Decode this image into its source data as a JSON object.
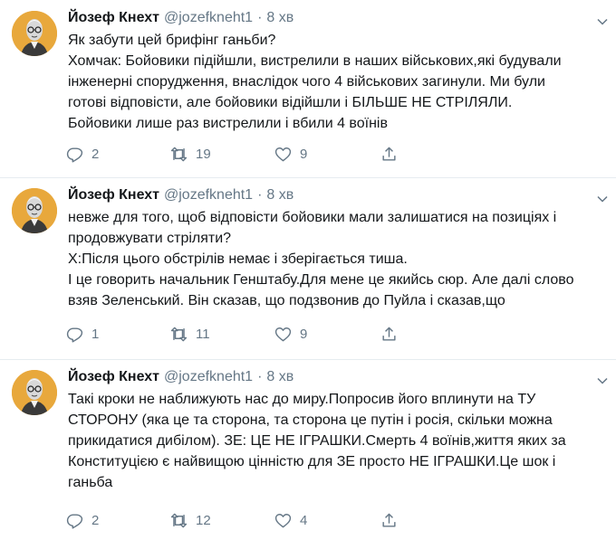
{
  "tweets": [
    {
      "author": "Йозеф Кнехт",
      "handle": "@jozefkneht1",
      "separator": "·",
      "time": "8 хв",
      "text": "Як забути цей брифінг ганьби?\nХомчак: Бойовики підійшли, вистрелили в наших військових,які будували\nінженерні спорудження, внаслідок чого 4 військових загинули. Ми були\nготові відповісти, але бойовики відійшли і БІЛЬШЕ НЕ СТРІЛЯЛИ.\nБойовики лише раз вистрелили і вбили 4 воїнів",
      "replies": "2",
      "retweets": "19",
      "likes": "9"
    },
    {
      "author": "Йозеф Кнехт",
      "handle": "@jozefkneht1",
      "separator": "·",
      "time": "8 хв",
      "text": "невже для того, щоб відповісти бойовики мали залишатися на позиціях і\nпродовжувати стріляти?\nХ:Після цього обстрілів немає і зберігається тиша.\nІ це говорить начальник Генштабу.Для мене це якийсь сюр. Але далі слово\nвзяв Зеленський. Він сказав, що подзвонив до Пуйла і сказав,що",
      "replies": "1",
      "retweets": "11",
      "likes": "9"
    },
    {
      "author": "Йозеф Кнехт",
      "handle": "@jozefkneht1",
      "separator": "·",
      "time": "8 хв",
      "text": "Такі кроки не наближують нас до миру.Попросив його вплинути на ТУ\nСТОРОНУ (яка це та сторона, та сторона це путін і росія, скільки можна\nприкидатися дибілом). ЗЕ: ЦЕ НЕ ІГРАШКИ.Смерть 4 воїнів,життя яких за\nКонституцією є найвищою цінністю для ЗЕ просто НЕ ІГРАШКИ.Це шок і\nганьба",
      "replies": "2",
      "retweets": "12",
      "likes": "4"
    }
  ],
  "icons": {
    "reply": "reply-icon",
    "retweet": "retweet-icon",
    "like": "like-icon",
    "share": "share-icon",
    "caret": "chevron-down-icon"
  },
  "colors": {
    "text": "#14171a",
    "muted": "#657786",
    "divider": "#e6ecf0",
    "avatar_bg": "#e8a83c"
  }
}
